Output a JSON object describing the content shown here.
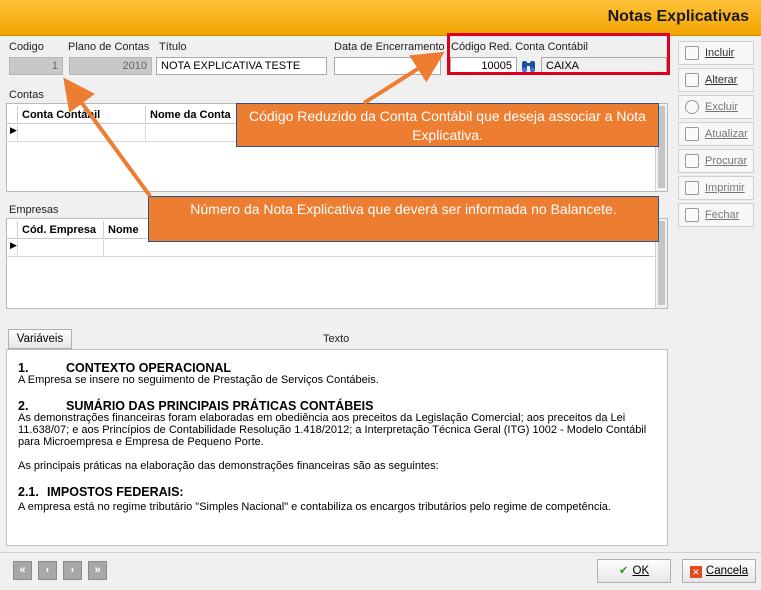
{
  "window": {
    "title": "Notas Explicativas"
  },
  "header_fields": {
    "codigo_label": "Codigo",
    "codigo_value": "1",
    "plano_label": "Plano de Contas",
    "plano_value": "2010",
    "titulo_label": "Título",
    "titulo_value": "NOTA EXPLICATIVA TESTE",
    "data_label": "Data de Encerramento",
    "data_value": "",
    "conta_label": "Código Red. Conta Contábil",
    "conta_codigo": "10005",
    "conta_nome": "CAIXA"
  },
  "contas": {
    "label": "Contas",
    "columns": [
      "Conta Contábil",
      "Nome da Conta"
    ]
  },
  "empresas": {
    "label": "Empresas",
    "columns": [
      "Cód. Empresa",
      "Nome"
    ]
  },
  "side_buttons": {
    "incluir": "Incluir",
    "alterar": "Alterar",
    "excluir": "Excluir",
    "atualizar": "Atualizar",
    "procurar": "Procurar",
    "imprimir": "Imprimir",
    "fechar": "Fechar"
  },
  "callouts": {
    "codigo_reduzido": "Código Reduzido da Conta Contábil que deseja associar a Nota Explicativa.",
    "numero_nota": "Número da Nota Explicativa que deverá ser informada no Balancete."
  },
  "texto": {
    "variaveis_button": "Variáveis",
    "label": "Texto",
    "s1_num": "1.",
    "s1_title": "CONTEXTO OPERACIONAL",
    "s1_body": "A Empresa se insere no seguimento de Prestação de Serviços Contábeis.",
    "s2_num": "2.",
    "s2_title": "SUMÁRIO DAS PRINCIPAIS PRÁTICAS CONTÁBEIS",
    "s2_body": "As demonstrações financeiras foram elaboradas em obediência aos preceitos da Legislação Comercial; aos preceitos da Lei 11.638/07; e aos Princípios de Contabilidade Resolução 1.418/2012; a Interpretação Técnica Geral (ITG) 1002 - Modelo Contábil para Microempresa e Empresa de Pequeno Porte.",
    "s2_body2": "As principais práticas na elaboração das demonstrações financeiras são as seguintes:",
    "s21_num": "2.1.",
    "s21_title": "IMPOSTOS FEDERAIS:",
    "s21_body": " A empresa está no regime tributário \"Simples Nacional\" e contabiliza os encargos tributários pelo regime de competência."
  },
  "footer": {
    "nav": [
      "«",
      "‹",
      "›",
      "»"
    ],
    "ok": "OK",
    "cancela": "Cancela"
  },
  "colors": {
    "titlebar": "#f2a400",
    "callout": "#ed7d31",
    "highlight": "#e0001b"
  }
}
